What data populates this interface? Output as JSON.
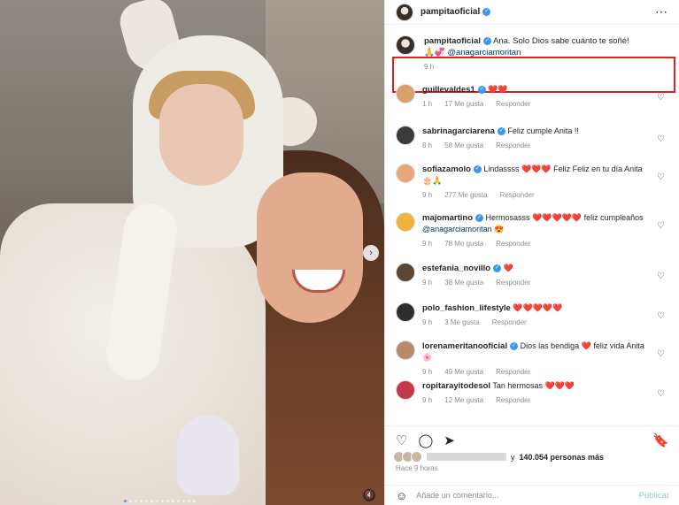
{
  "post": {
    "author": "pampitaoficial",
    "more_icon": "⋯",
    "slide_count": 14,
    "active_slide": 1
  },
  "caption": {
    "author": "pampitaoficial",
    "text": "Ana. Solo Dios sabe cuánto te soñé!",
    "emoji": "🙏💞",
    "mention": "@anagarciamoritan",
    "time": "9 h"
  },
  "comments": [
    {
      "user": "guillevaldes1",
      "verified": true,
      "text": "",
      "hearts": "❤️❤️",
      "time": "1 h",
      "likes": "17 Me gusta",
      "reply": "Responder",
      "avatar_color": "#d9a16a"
    },
    {
      "user": "sabrinagarciarena",
      "verified": true,
      "text": "Feliz cumple Anita !!",
      "hearts": "",
      "time": "8 h",
      "likes": "58 Me gusta",
      "reply": "Responder",
      "avatar_color": "#3b3b3b"
    },
    {
      "user": "sofiazamolo",
      "verified": true,
      "text": "Lindassss",
      "hearts": "❤️❤️❤️",
      "text2": "Feliz Feliz en tu día Anita",
      "line2": "🎂🙏",
      "time": "9 h",
      "likes": "277 Me gusta",
      "reply": "Responder",
      "avatar_color": "#e8a77a"
    },
    {
      "user": "majomartino",
      "verified": true,
      "text": "Hermosasss",
      "hearts": "❤️❤️❤️❤️❤️",
      "text2": "feliz cumpleaños",
      "mention": "@anagarciamoritan",
      "line2": "😍",
      "time": "9 h",
      "likes": "78 Me gusta",
      "reply": "Responder",
      "avatar_color": "#f2b23e"
    },
    {
      "user": "estefania_novillo",
      "verified": true,
      "text": "",
      "hearts": "❤️",
      "time": "9 h",
      "likes": "38 Me gusta",
      "reply": "Responder",
      "avatar_color": "#5b4634"
    },
    {
      "user": "polo_fashion_lifestyle",
      "verified": false,
      "text": "",
      "hearts": "❤️❤️❤️❤️❤️",
      "time": "9 h",
      "likes": "3 Me gusta",
      "reply": "Responder",
      "avatar_color": "#2e2e2e"
    },
    {
      "user": "lorenameritanooficial",
      "verified": true,
      "text": "Dios las bendiga",
      "hearts": "❤️",
      "text2": "feliz vida Anita",
      "line2": "🌸",
      "time": "9 h",
      "likes": "49 Me gusta",
      "reply": "Responder",
      "avatar_color": "#b9876b"
    },
    {
      "user": "ropitarayitodesol",
      "verified": false,
      "text": "Tan hermosas",
      "hearts": "❤️❤️❤️",
      "time": "9 h",
      "likes": "12 Me gusta",
      "reply": "Responder",
      "avatar_color": "#c23a4a"
    }
  ],
  "actions": {
    "like_icon": "♡",
    "comment_icon": "◯",
    "share_icon": "➤",
    "save_icon": "🔖"
  },
  "likes": {
    "prefix": "y",
    "count": "140.054 personas más"
  },
  "time_ago": "Hace 9 horas",
  "composer": {
    "emoji_icon": "☺",
    "placeholder": "Añade un comentario...",
    "post_label": "Publicar"
  },
  "colors": {
    "verified": "#3897f0",
    "heart": "#ed1c2c",
    "highlight": "#e0211c",
    "post_button": "#8ec2f5"
  }
}
